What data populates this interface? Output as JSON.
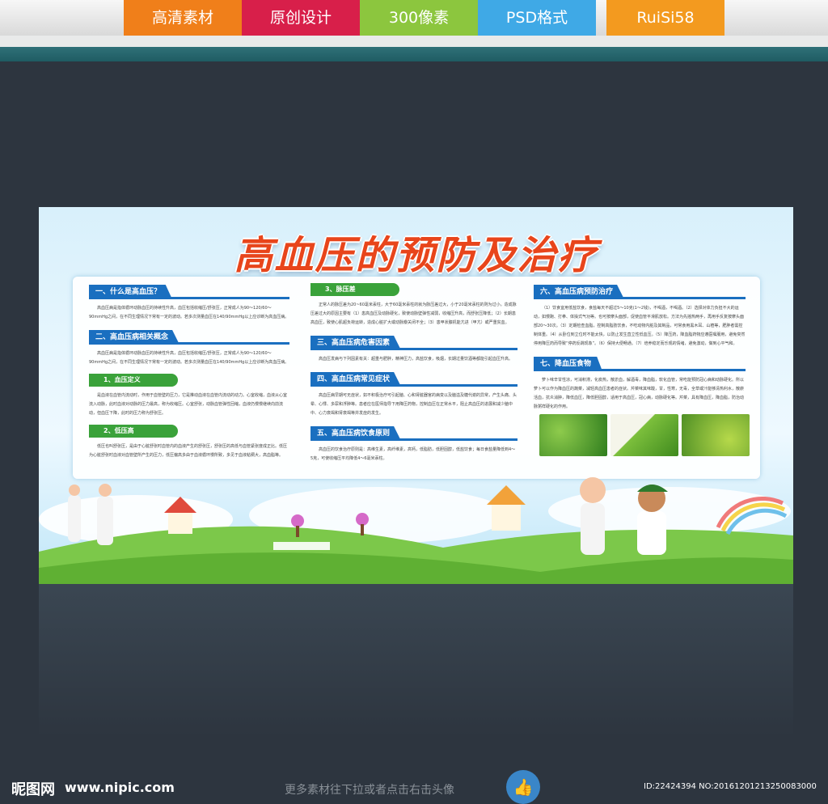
{
  "tags": [
    {
      "label": "高清素材",
      "color": "#f07f1a"
    },
    {
      "label": "原创设计",
      "color": "#d81f4a"
    },
    {
      "label": "300像素",
      "color": "#8cc63e"
    },
    {
      "label": "PSD格式",
      "color": "#3fa9e6"
    },
    {
      "label": "RuiSi58",
      "color": "#f39a1f"
    }
  ],
  "board": {
    "title": "高血压的预防及治疗",
    "col1": {
      "s1_title": "一、什么是高血压？",
      "s1_text": "高血压病是指体循环动脉血压的持续性升高，血压包括收缩压/舒张压，正常成人为90～120/60～90mmHg之间，在不同生理情况下常有一定的波动。若多次测量血压在140/90mmHg以上应诊断为高血压病。",
      "s2_title": "二、高血压病相关概念",
      "s2_text": "高血压病是指体循环动脉血压的持续性升高，血压包括收缩压/舒张压，正常成人为90～120/60～90mmHg之间，在不同生理情况下常有一定的波动。若多次测量血压在140/90mmHg以上应诊断为高血压病。",
      "s3_title": "1、血压定义",
      "s3_text": "是血液在血管内流动时，作用于血管壁的压力，它是推动血液在血管内流动的动力。心室收缩，血液从心室流入动脉，此时血液对动脉的压力最高，称为收缩压。心室舒张，动脉血管弹性回缩，血液仍慢慢继续向前流动，但血压下降，此时的压力称为舒张压。",
      "s4_title": "2、低压高",
      "s4_text": "低压也叫舒张压，是由于心脏舒张时血管内的血液产生的舒张压，舒张压的高低与血管紧张度成正比。低压为心脏舒张时血液对血管壁所产生的压力，低压偏高多由于血液循环慢所致，多见于血液粘稠大，高血脂等。"
    },
    "col2": {
      "s1_title": "3、脉压差",
      "s1_text": "正常人的脉压差为20~60毫米汞柱，大于60毫米汞柱的就为脉压差过大，小于20毫米汞柱的则为过小。造成脉压差过大的原因主要有（1）患高血压及动脉硬化，致使动脉壁弹性减弱，收缩压升高，而舒张压降低；（2）长期患高血压，致使心肌超负荷运转，造成心脏扩大或动脉瓣关闭不全；（3）患甲状腺机能亢进（甲亢）或严重贫血。",
      "s2_title": "三、高血压病危害因素",
      "s2_text": "高血压发病与下列因素有关：超重与肥胖，精神压力，高盐饮食，吸烟，长期过量饮酒等都能引起血压升高。",
      "s3_title": "四、高血压病常见症状",
      "s3_text": "高血压病早期可无症状，如不积极治疗可引起脑、心和肾脏器官的病变以及脑溢及糖代谢的异常，产生头痛、头晕、心悸、多尿和浮肿等。患者应在医师指导下用降压药物，控制血压在正常水平，阻止高血压的进展和减少脑中中、心力衰竭和肾衰竭等并发症的发生。",
      "s4_title": "五、高血压病饮食原则",
      "s4_text": "高血压的饮食治疗原则是：高维生素，高纤维素，高钙，低脂肪，低胆固醇，低盐饮食；每日食盐量降低到4～5克，可使收缩压平均降低4～6毫米汞柱。"
    },
    "col3": {
      "s1_title": "六、高血压病预防治疗",
      "s1_text": "（1）饮食宜用低盐饮食，食盐每天不超过5～10克(1～2钱)，不喝酒，不喝酒。（2）选择对体力负担不大的运动，如慢跑、打拳、体操式气功等。也可按摩头面部，促使血管平滑肌放松。方法为先摇热两手，再用手反复按摩头面部20～30次。（3）定期检查血脂，控制高脂肪饮食，不吃动物内脏及其制品，可常食用黑木耳、山楂等，肥胖者需控制体重。（4）从卧位到立位时不能太快，以防止发生直立性低血压。（5）降压药，降血脂药物应遵医嘱服用，避免突然停用降压药而导致“停药反跳现象”。（6）保持大便畅通。（7）培养稳定而乐观的情绪，避免激动，做到心平气和。",
      "s2_title": "七、降血压食物",
      "s2_text": "萝卜味辛甘性凉，可消积滞，化痰热，散淤血，解酒毒，降血脂，软化血管，常吃能预防冠心病和动脉硬化。所以萝卜可以作为降血压的蔬菜，减轻高血压患者的症状。芹菜味其味酸，甘，性寒，无毒，全草或汁能够清热利水，散瘀活血，抗炎消肿，降低血压，降低胆固醇，适用于高血压，冠心病，动脉硬化等。芹菜，具有降血压，降血脂，防治动脉粥样硬化的作用。"
    }
  },
  "footer": {
    "logo": "昵图网",
    "url": "www.nipic.com",
    "hint": "更多素材往下拉或者点击右击头像",
    "id": "ID:22424394 NO:20161201213250083000"
  }
}
